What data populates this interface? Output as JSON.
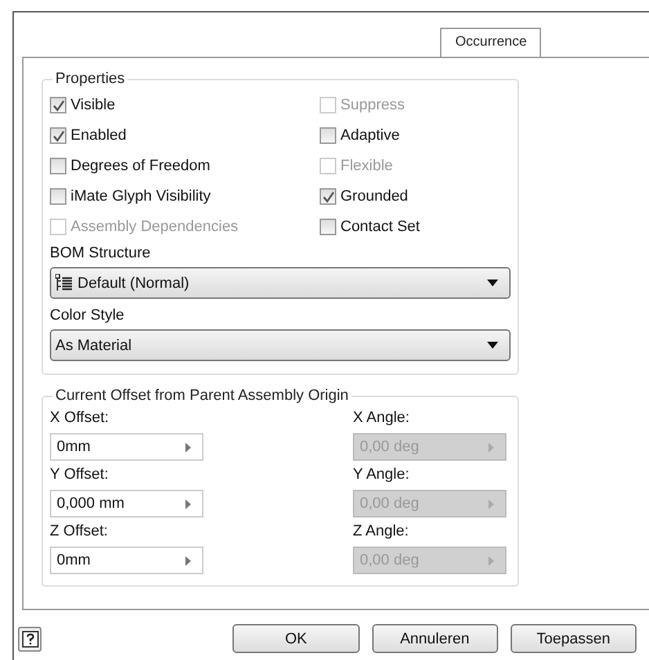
{
  "tabs": [
    {
      "label": "Occurrence",
      "selected": true
    }
  ],
  "properties": {
    "title": "Properties",
    "checkboxes": [
      {
        "label": "Visible",
        "checked": true,
        "disabled": false
      },
      {
        "label": "Suppress",
        "checked": false,
        "disabled": true
      },
      {
        "label": "Enabled",
        "checked": true,
        "disabled": false
      },
      {
        "label": "Adaptive",
        "checked": false,
        "disabled": false
      },
      {
        "label": "Degrees of Freedom",
        "checked": false,
        "disabled": false
      },
      {
        "label": "Flexible",
        "checked": false,
        "disabled": true
      },
      {
        "label": "iMate Glyph Visibility",
        "checked": false,
        "disabled": false
      },
      {
        "label": "Grounded",
        "checked": true,
        "disabled": false
      },
      {
        "label": "Assembly Dependencies",
        "checked": false,
        "disabled": true
      },
      {
        "label": "Contact Set",
        "checked": false,
        "disabled": false
      }
    ],
    "dropdowns": [
      {
        "label": "BOM Structure",
        "value": "Default (Normal)",
        "icon": true
      },
      {
        "label": "Color Style",
        "value": "As Material",
        "icon": false
      }
    ]
  },
  "offset": {
    "title": "Current Offset from Parent Assembly Origin",
    "fields": [
      {
        "label": "X Offset:",
        "value": "0mm",
        "disabled": false
      },
      {
        "label": "X Angle:",
        "value": "0,00 deg",
        "disabled": true
      },
      {
        "label": "Y Offset:",
        "value": "0,000 mm",
        "disabled": false
      },
      {
        "label": "Y Angle:",
        "value": "0,00 deg",
        "disabled": true
      },
      {
        "label": "Z Offset:",
        "value": "0mm",
        "disabled": false
      },
      {
        "label": "Z Angle:",
        "value": "0,00 deg",
        "disabled": true
      }
    ]
  },
  "buttons": [
    "OK",
    "Annuleren",
    "Toepassen"
  ]
}
